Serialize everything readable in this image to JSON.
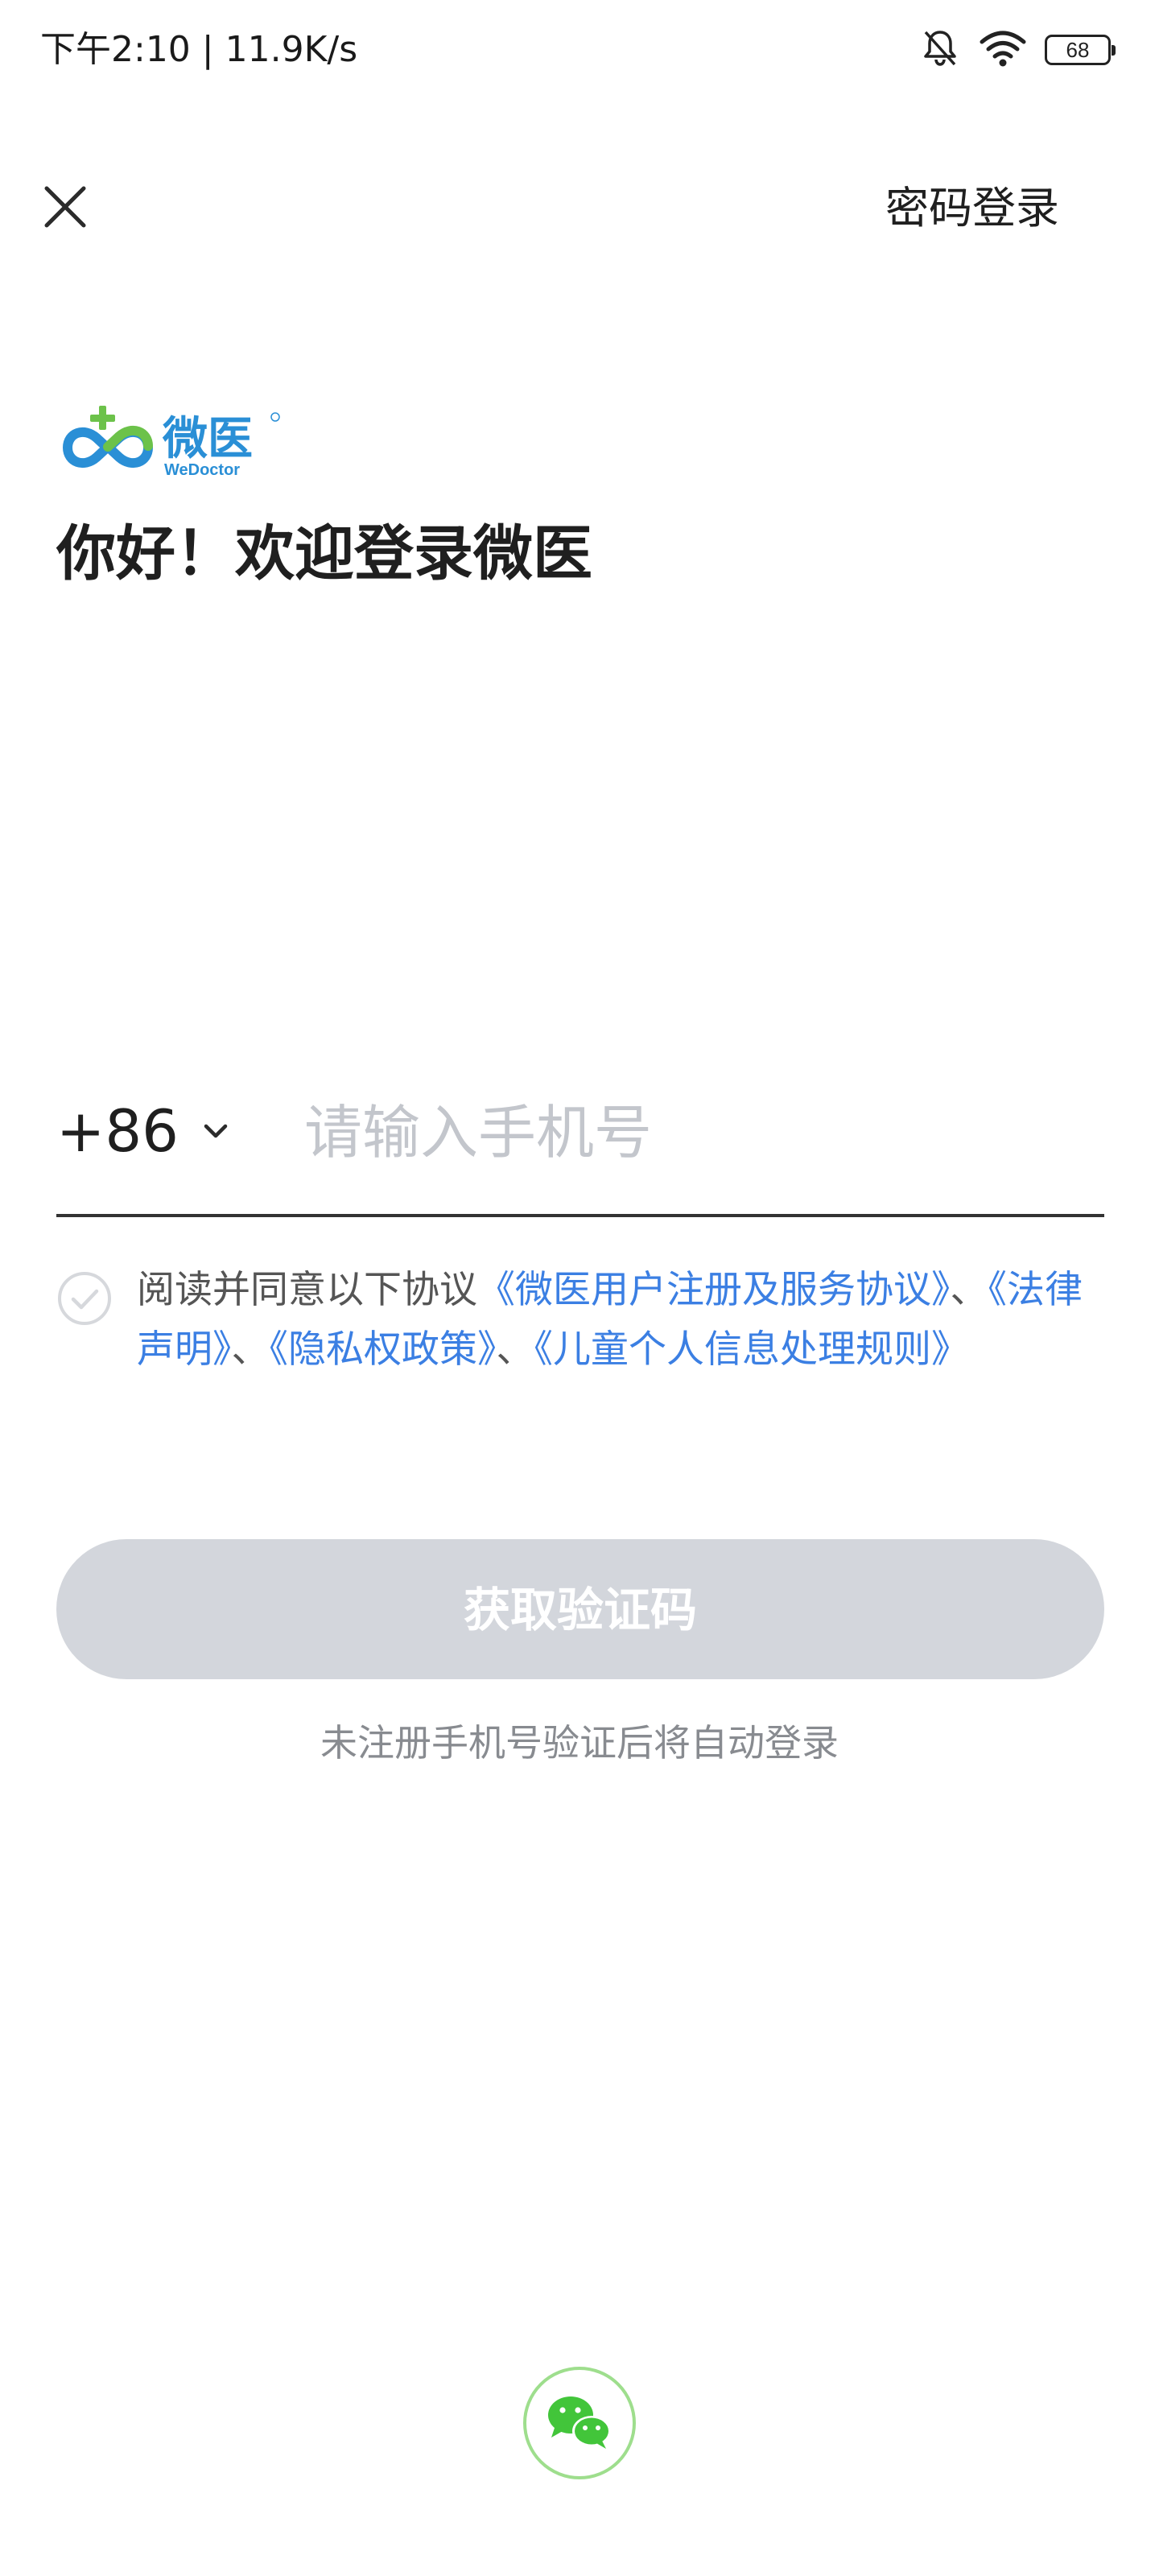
{
  "status_bar": {
    "time_speed": "下午2:10 | 11.9K/s",
    "battery_level": "68",
    "icons": [
      "bell-off-icon",
      "wifi-icon",
      "battery-icon"
    ]
  },
  "nav": {
    "close_icon": "close-icon",
    "password_login_label": "密码登录"
  },
  "brand": {
    "logo_text_cn": "微医",
    "logo_text_en": "WeDoctor",
    "greeting": "你好！欢迎登录微医"
  },
  "phone": {
    "country_code": "+86",
    "placeholder": "请输入手机号",
    "value": ""
  },
  "agreement": {
    "prefix": "阅读并同意以下协议",
    "links": [
      "《微医用户注册及服务协议》",
      "《法律声明》",
      "《隐私权政策》",
      "《儿童个人信息处理规则》"
    ],
    "separator": "、",
    "checked": false
  },
  "actions": {
    "get_code_label": "获取验证码",
    "hint": "未注册手机号验证后将自动登录",
    "wechat_icon": "wechat-icon"
  },
  "colors": {
    "link": "#3b7fe3",
    "button_disabled": "#d3d6dc",
    "wechat_green": "#42c53a",
    "logo_green": "#6cc24a",
    "logo_blue": "#2a8fd6"
  }
}
